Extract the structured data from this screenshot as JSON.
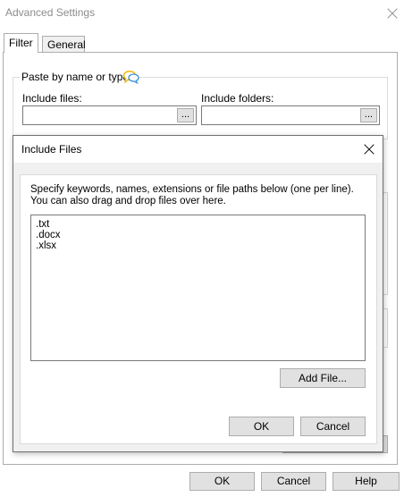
{
  "window": {
    "title": "Advanced Settings"
  },
  "tabs": [
    {
      "label": "Filter",
      "active": true
    },
    {
      "label": "General",
      "active": false
    }
  ],
  "filter": {
    "group_label": "Paste by name or type",
    "include_files_label": "Include files:",
    "include_folders_label": "Include folders:",
    "include_files_value": "",
    "include_folders_value": "",
    "browse_label": "..."
  },
  "dialog": {
    "title": "Include Files",
    "instructions": "Specify keywords, names, extensions or file paths below (one per line).  You can also drag and drop files over here.",
    "entries": [
      ".txt",
      ".docx",
      ".xlsx"
    ],
    "add_file_label": "Add File...",
    "ok_label": "OK",
    "cancel_label": "Cancel"
  },
  "footer": {
    "ok_label": "OK",
    "cancel_label": "Cancel",
    "help_label": "Help"
  },
  "colors": {
    "accent_icon": "#f0b400",
    "accent_icon_2": "#3c8fd8",
    "dialog_bg": "#f0f0f0"
  },
  "icons": {
    "paste_hint": "speech-bubbles-icon"
  }
}
